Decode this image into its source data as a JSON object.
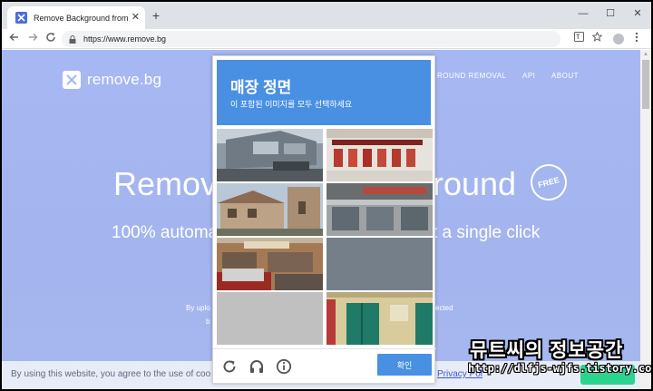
{
  "browser": {
    "tab_title": "Remove Background from Imag",
    "tab_close": "✕",
    "new_tab": "+",
    "url": "https://www.remove.bg",
    "window_controls": {
      "minimize": "—",
      "maximize": "☐",
      "close": "✕"
    }
  },
  "site": {
    "logo_text": "remove.bg",
    "nav": {
      "removal": "ROUND REMOVAL",
      "api": "API",
      "about": "ABOUT"
    },
    "hero_left": "Remov",
    "hero_right": "round",
    "free_badge": "FREE",
    "sub_left": "100% automa",
    "sub_right": "t a single click",
    "small_left": "By uplo",
    "small_left2": "b",
    "small_right": "ected",
    "cookie_text": "By using this website, you agree to the use of coo",
    "cookie_link": "Privacy Pol"
  },
  "captcha": {
    "title": "매장 정면",
    "subtitle": "이 포함된 이미지를 모두 선택하세요",
    "verify_label": "확인",
    "icons": {
      "reload": "reload-icon",
      "audio": "headphones-icon",
      "info": "info-icon"
    }
  },
  "watermark": {
    "line1": "뮤트씨의 정보공간",
    "line2": "http://dlfjs-wjfs.tistory.com/"
  },
  "colors": {
    "site_blue": "#4a6ce0",
    "captcha_blue": "#4a90e2",
    "cookie_accent": "#2bd48f"
  }
}
